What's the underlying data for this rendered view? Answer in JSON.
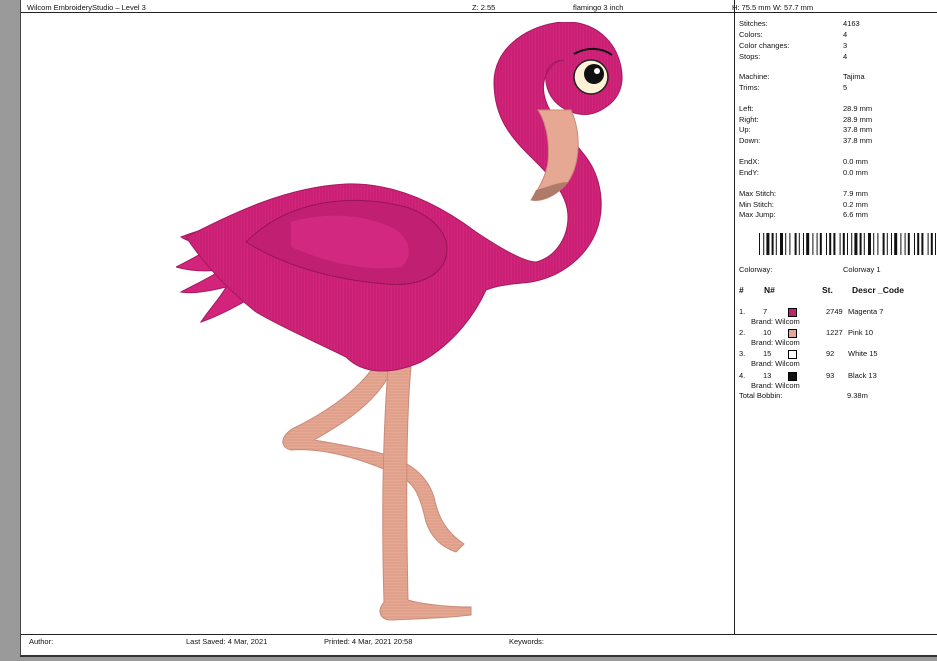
{
  "header": {
    "app_title": "Wilcom EmbroideryStudio – Level 3",
    "zoom": "Z: 2.55",
    "file_name": "flamingo 3 inch",
    "dimensions": "H: 75.5 mm   W: 57.7 mm"
  },
  "stats": [
    {
      "label": "Stitches:",
      "value": "4163"
    },
    {
      "label": "Colors:",
      "value": "4"
    },
    {
      "label": "Color changes:",
      "value": "3"
    },
    {
      "label": "Stops:",
      "value": "4"
    },
    {
      "label": "Machine:",
      "value": "Tajima"
    },
    {
      "label": "Trims:",
      "value": "5"
    },
    {
      "label": "Left:",
      "value": "28.9 mm"
    },
    {
      "label": "Right:",
      "value": "28.9 mm"
    },
    {
      "label": "Up:",
      "value": "37.8 mm"
    },
    {
      "label": "Down:",
      "value": "37.8 mm"
    },
    {
      "label": "EndX:",
      "value": "0.0 mm"
    },
    {
      "label": "EndY:",
      "value": "0.0 mm"
    },
    {
      "label": "Max Stitch:",
      "value": "7.9 mm"
    },
    {
      "label": "Min Stitch:",
      "value": "0.2 mm"
    },
    {
      "label": "Max Jump:",
      "value": "6.6 mm"
    }
  ],
  "colorway": {
    "label": "Colorway:",
    "value": "Colorway 1"
  },
  "table_headers": {
    "num": "#",
    "n": "N#",
    "st": "St.",
    "descr": "Descr _Code"
  },
  "colors": [
    {
      "index": "1.",
      "n": "7",
      "hex": "#c2246b",
      "stitches": "2749",
      "desc": "Magenta 7",
      "brand": "Brand: Wilcom"
    },
    {
      "index": "2.",
      "n": "10",
      "hex": "#e8a497",
      "stitches": "1227",
      "desc": "Pink 10",
      "brand": "Brand: Wilcom"
    },
    {
      "index": "3.",
      "n": "15",
      "hex": "#ffffff",
      "stitches": "92",
      "desc": "White 15",
      "brand": "Brand: Wilcom"
    },
    {
      "index": "4.",
      "n": "13",
      "hex": "#111111",
      "stitches": "93",
      "desc": "Black 13",
      "brand": "Brand: Wilcom"
    }
  ],
  "bobbin": {
    "label": "Total Bobbin:",
    "value": "9.38m"
  },
  "footer": {
    "author": "Author:",
    "last_saved": "Last Saved:  4 Mar, 2021",
    "printed": "Printed:  4 Mar, 2021 20:58",
    "keywords": "Keywords:"
  },
  "design": {
    "icon": "flamingo-embroidery",
    "colors": {
      "body": "#d3237b",
      "body_dark": "#b01c66",
      "legs": "#e6a793",
      "beak_dark": "#c98c7a"
    }
  }
}
